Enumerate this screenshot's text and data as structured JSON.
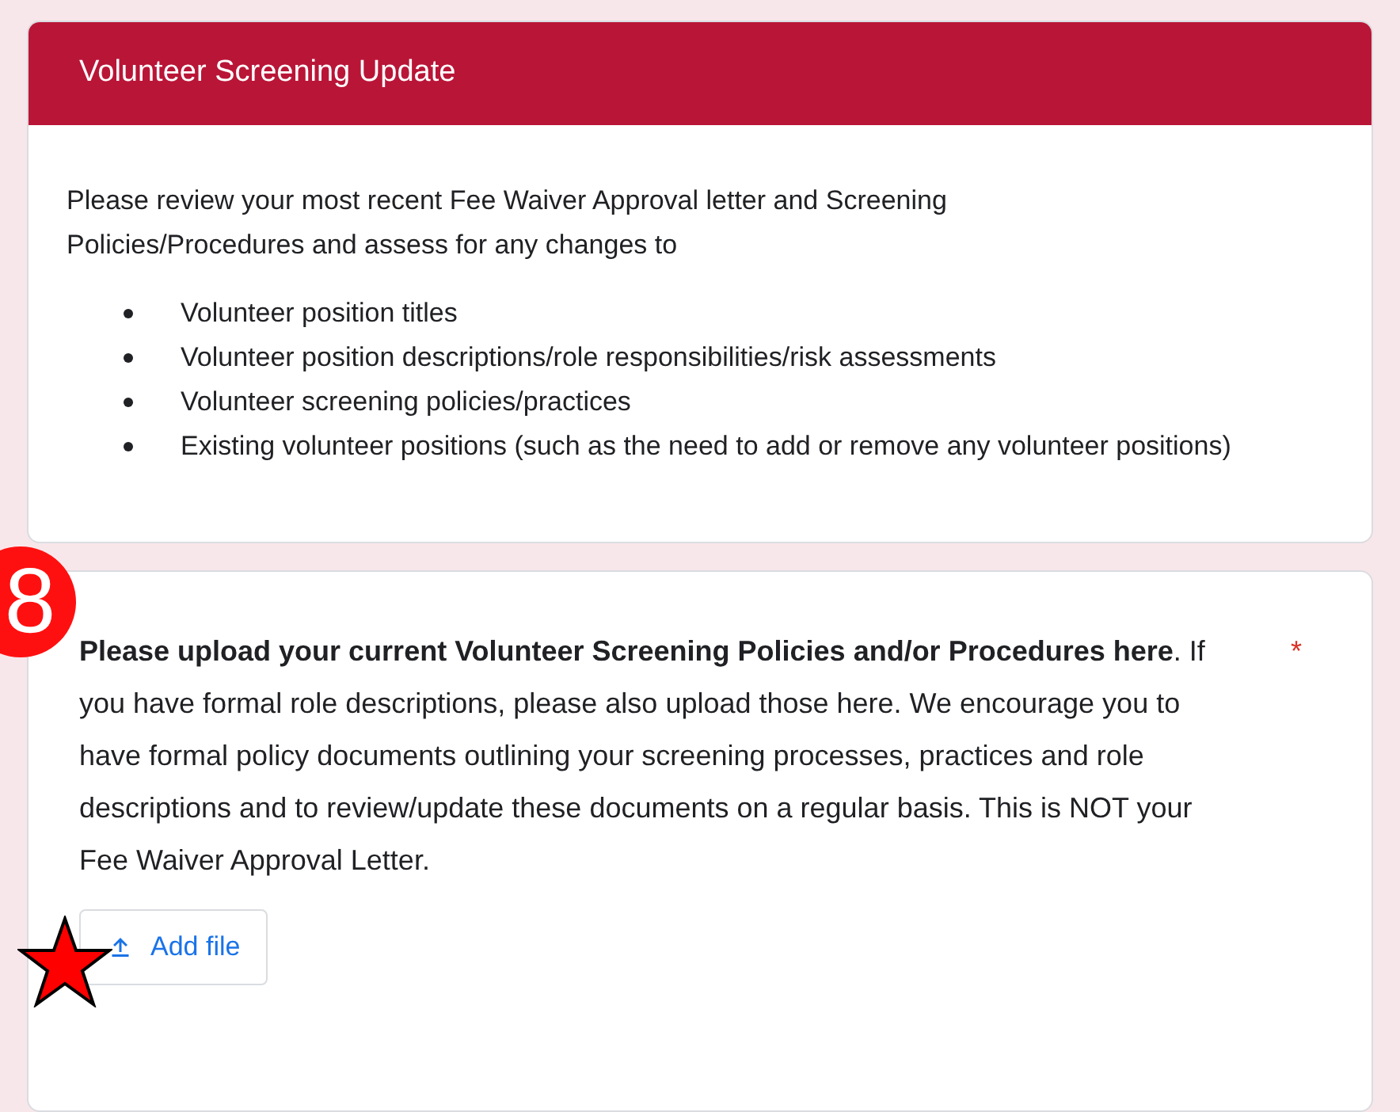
{
  "header": {
    "title": "Volunteer Screening Update"
  },
  "intro": {
    "text": "Please review your most recent Fee Waiver Approval letter and Screening Policies/Procedures and assess for any changes to",
    "bullets": [
      "Volunteer position titles",
      "Volunteer position descriptions/role responsibilities/risk assessments",
      "Volunteer screening policies/practices",
      "Existing volunteer positions (such as the need to add or remove any volunteer positions)"
    ]
  },
  "badge": {
    "text": "8"
  },
  "question": {
    "text": "**Please upload your current Volunteer Screening Policies and/or Procedures here**. If you have formal role descriptions, please also upload those here. We encourage you to have formal policy documents outlining your screening processes, practices and role descriptions and to review/update these documents on a regular basis. This is NOT your Fee Waiver Approval Letter.",
    "required_mark": "*",
    "button": "Add file"
  }
}
